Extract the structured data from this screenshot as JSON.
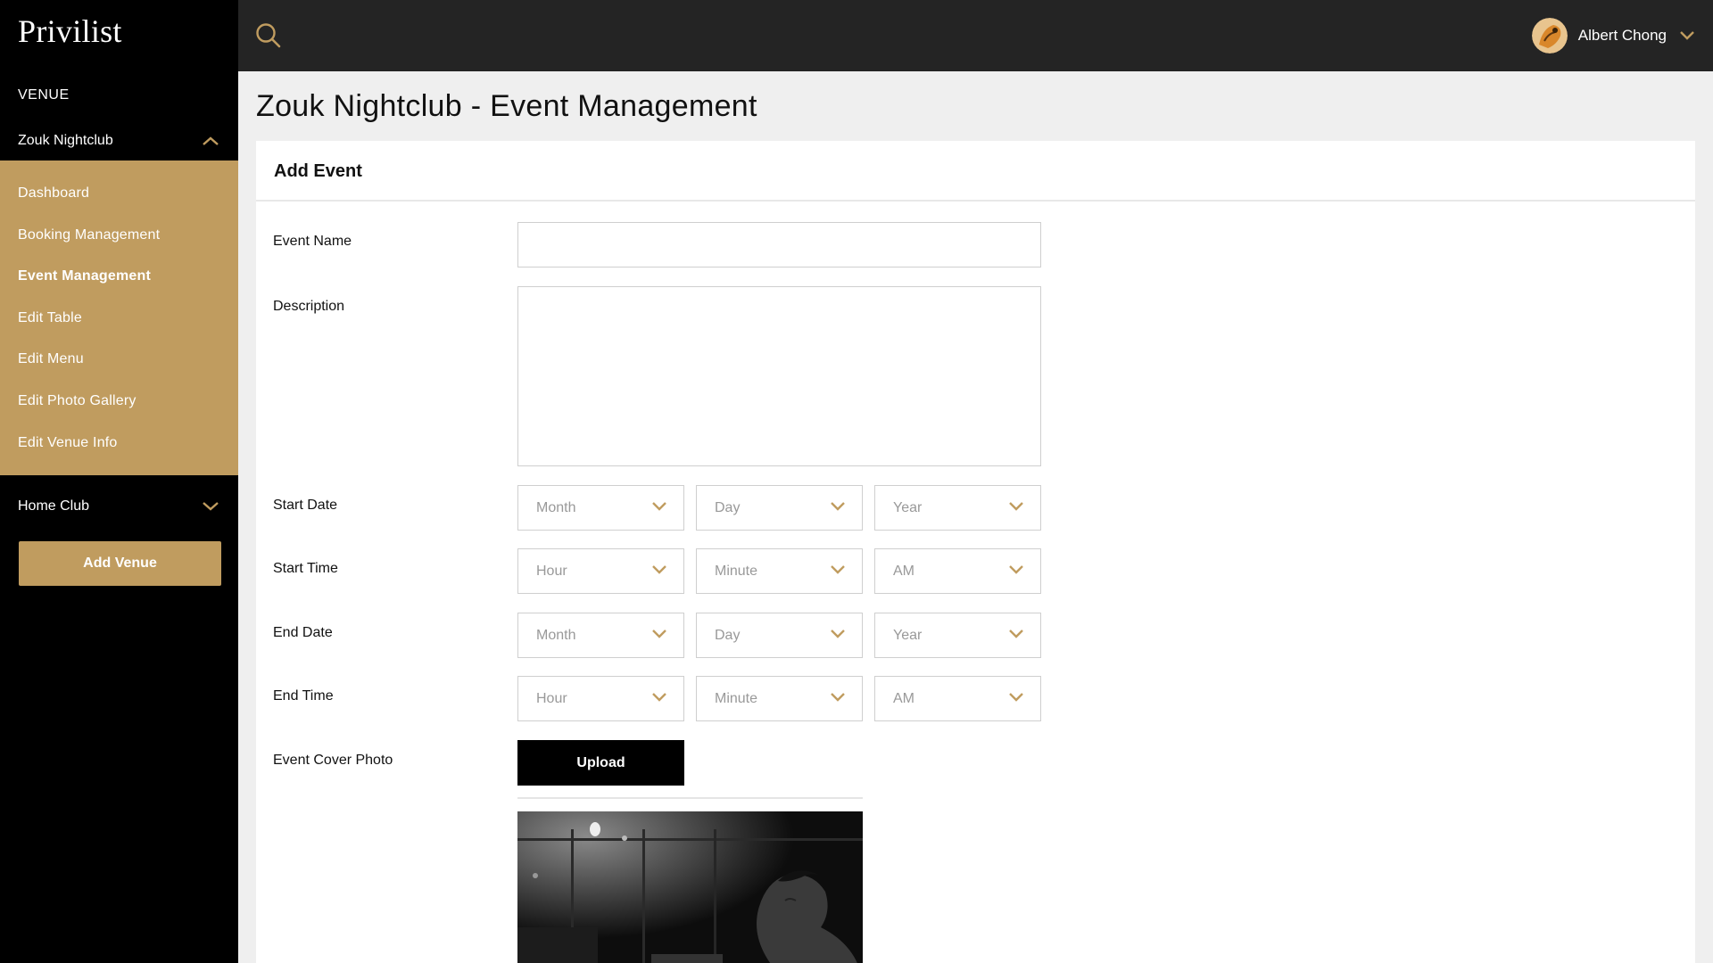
{
  "app": {
    "logo": "Privilist"
  },
  "sidebar": {
    "venue_heading": "VENUE",
    "current_venue": "Zouk Nightclub",
    "items": [
      {
        "label": "Dashboard"
      },
      {
        "label": "Booking Management"
      },
      {
        "label": "Event Management",
        "active": true
      },
      {
        "label": "Edit Table"
      },
      {
        "label": "Edit Menu"
      },
      {
        "label": "Edit Photo Gallery"
      },
      {
        "label": "Edit Venue Info"
      }
    ],
    "other_venue": "Home Club",
    "add_venue_label": "Add Venue"
  },
  "topbar": {
    "search_icon": "search-icon",
    "user_name": "Albert Chong"
  },
  "page": {
    "title": "Zouk Nightclub - Event Management"
  },
  "form": {
    "header": "Add Event",
    "event_name": {
      "label": "Event Name",
      "value": ""
    },
    "description": {
      "label": "Description",
      "value": ""
    },
    "start_date": {
      "label": "Start Date",
      "month": "Month",
      "day": "Day",
      "year": "Year"
    },
    "start_time": {
      "label": "Start Time",
      "hour": "Hour",
      "minute": "Minute",
      "ampm": "AM"
    },
    "end_date": {
      "label": "End Date",
      "month": "Month",
      "day": "Day",
      "year": "Year"
    },
    "end_time": {
      "label": "End Time",
      "hour": "Hour",
      "minute": "Minute",
      "ampm": "AM"
    },
    "cover_photo": {
      "label": "Event Cover Photo",
      "upload_label": "Upload"
    }
  },
  "colors": {
    "accent": "#c09c5f",
    "sidebar_bg": "#000000",
    "topbar_bg": "#242424",
    "page_bg": "#efefef"
  }
}
